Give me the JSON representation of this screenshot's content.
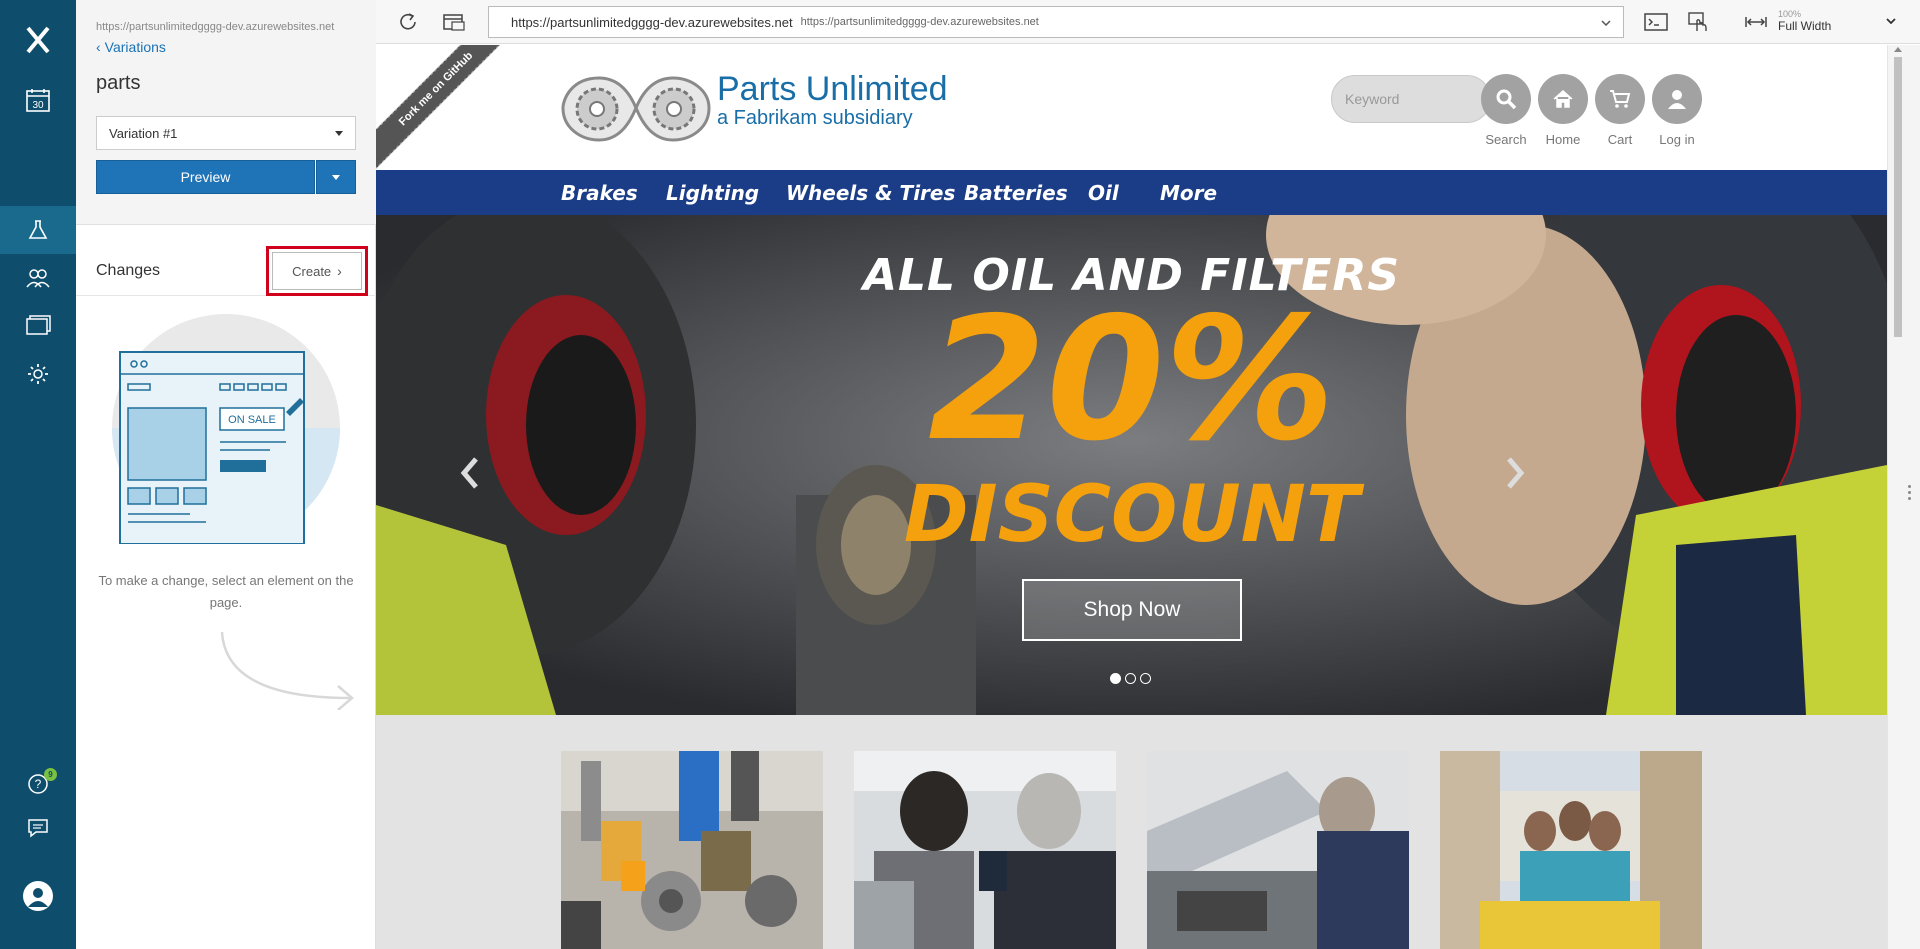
{
  "rail": {
    "logo_icon": "optimizely-x-logo",
    "calendar_day": "30",
    "items": [
      {
        "icon": "flask-icon",
        "active": true
      },
      {
        "icon": "audiences-icon",
        "active": false
      },
      {
        "icon": "pages-icon",
        "active": false
      },
      {
        "icon": "gear-icon",
        "active": false
      }
    ],
    "help_badge": "9",
    "accent": "#0e4d6b"
  },
  "panel": {
    "site_url": "https://partsunlimitedgggg-dev.azurewebsites.net",
    "back_label": "Variations",
    "experiment_name": "parts",
    "variation_selected": "Variation #1",
    "preview_label": "Preview",
    "changes_label": "Changes",
    "create_label": "Create",
    "illustration_tag": "ON SALE",
    "hint": "To make a change, select an element on the page."
  },
  "toolbar": {
    "url_main": "https://partsunlimitedgggg-dev.azurewebsites.net",
    "url_sub": "https://partsunlimitedgggg-dev.azurewebsites.net",
    "zoom": "100%",
    "width_mode": "Full Width"
  },
  "site": {
    "ribbon": "Fork me on GitHub",
    "brand_title": "Parts Unlimited",
    "brand_subtitle": "a Fabrikam subsidiary",
    "search_placeholder": "Keyword",
    "nav": [
      {
        "label": "Search",
        "icon": "search-icon"
      },
      {
        "label": "Home",
        "icon": "home-icon"
      },
      {
        "label": "Cart",
        "icon": "cart-icon"
      },
      {
        "label": "Log in",
        "icon": "user-icon"
      }
    ],
    "menu": [
      "Brakes",
      "Lighting",
      "Wheels & Tires",
      "Batteries",
      "Oil",
      "More"
    ],
    "hero": {
      "line1": "ALL OIL AND FILTERS",
      "line2": "20%",
      "line3": "DISCOUNT",
      "cta": "Shop Now",
      "slide_active": 1,
      "slide_count": 3
    },
    "colors": {
      "brand_blue": "#1a6ea7",
      "menu_bg": "#1b3d87",
      "promo_orange": "#f5a00d",
      "highlight_red": "#d0021b"
    }
  }
}
